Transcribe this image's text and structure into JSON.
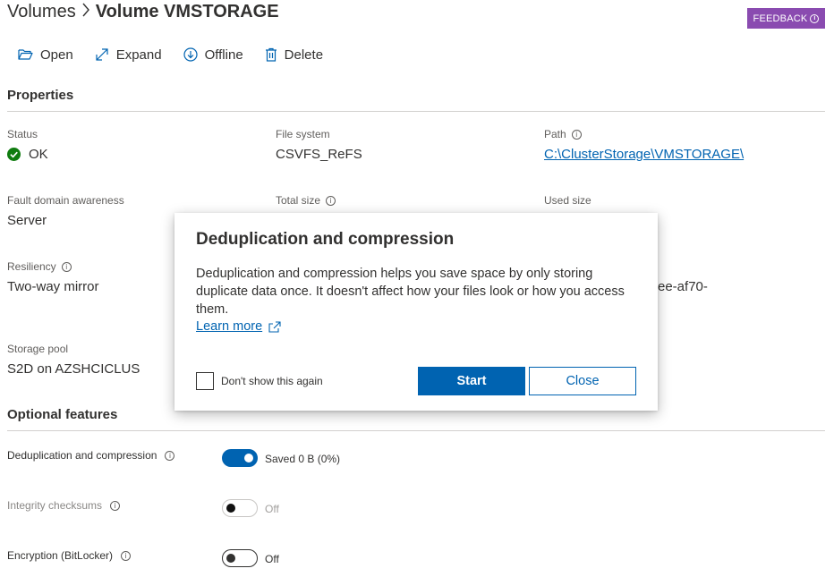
{
  "breadcrumb": {
    "parent": "Volumes",
    "separator": ">",
    "current": "Volume VMSTORAGE"
  },
  "feedback": {
    "label": "FEEDBACK",
    "icon": "info-icon"
  },
  "toolbar": [
    {
      "label": "Open",
      "icon": "folder-open-icon"
    },
    {
      "label": "Expand",
      "icon": "expand-arrow-icon"
    },
    {
      "label": "Offline",
      "icon": "arrow-down-circle-icon"
    },
    {
      "label": "Delete",
      "icon": "trash-icon"
    }
  ],
  "properties": {
    "title": "Properties",
    "status": {
      "label": "Status",
      "value": "OK",
      "icon": "check-circle-icon",
      "color": "#107c10"
    },
    "file_system": {
      "label": "File system",
      "value": "CSVFS_ReFS"
    },
    "path": {
      "label": "Path",
      "value": "C:\\ClusterStorage\\VMSTORAGE\\"
    },
    "fault_domain": {
      "label": "Fault domain awareness",
      "value": "Server"
    },
    "total_size": {
      "label": "Total size"
    },
    "used_size": {
      "label": "Used size"
    },
    "resiliency": {
      "label": "Resiliency",
      "value": "Two-way mirror"
    },
    "partial_id": {
      "value": "ee-af70-"
    },
    "storage_pool": {
      "label": "Storage pool",
      "value": "S2D on AZSHCICLUS"
    }
  },
  "optional_features": {
    "title": "Optional features",
    "dedup": {
      "label": "Deduplication and compression",
      "state": "Saved 0 B (0%)",
      "on": true
    },
    "integrity": {
      "label": "Integrity checksums",
      "state": "Off",
      "on": false,
      "disabled": true
    },
    "encryption": {
      "label": "Encryption (BitLocker)",
      "state": "Off",
      "on": false
    }
  },
  "dialog": {
    "title": "Deduplication and compression",
    "body": "Deduplication and compression helps you save space by only storing duplicate data once. It doesn't affect how your files look or how you access them.",
    "learn_more": "Learn more",
    "checkbox_label": "Don't show this again",
    "start_label": "Start",
    "close_label": "Close"
  },
  "colors": {
    "accent": "#0063b1",
    "feedback": "#8a4bb0",
    "ok": "#107c10"
  }
}
